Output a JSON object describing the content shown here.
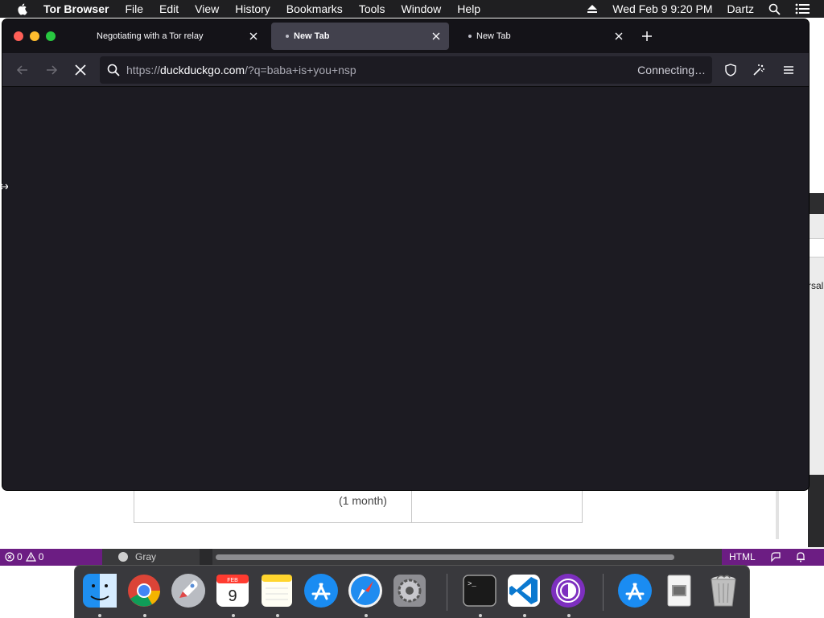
{
  "menubar": {
    "app_name": "Tor Browser",
    "items": [
      "File",
      "Edit",
      "View",
      "History",
      "Bookmarks",
      "Tools",
      "Window",
      "Help"
    ],
    "datetime": "Wed Feb 9  9:20 PM",
    "user": "Dartz",
    "icons": [
      "apple-icon",
      "eject-icon",
      "spotlight-search-icon",
      "notification-center-icon"
    ]
  },
  "browser": {
    "tabs": [
      {
        "title": "Negotiating with a Tor relay",
        "active": false,
        "loading_dot": false
      },
      {
        "title": "New Tab",
        "active": true,
        "loading_dot": true
      },
      {
        "title": "New Tab",
        "active": false,
        "loading_dot": true
      }
    ],
    "url": {
      "scheme": "https://",
      "domain": "duckduckgo.com",
      "path": "/?q=baba+is+you+nsp"
    },
    "status": "Connecting…",
    "nav_icons": [
      "back-icon",
      "forward-icon",
      "stop-icon",
      "shield-icon",
      "extensions-icon",
      "menu-icon"
    ]
  },
  "background": {
    "table_cell": "(1 month)",
    "right_fragment": "rsal",
    "status_left": {
      "errors": "0",
      "warnings": "0"
    },
    "gray_label": "Gray",
    "language": "HTML"
  },
  "dock": {
    "apps": [
      "finder-icon",
      "chrome-icon",
      "launchpad-icon",
      "calendar-icon",
      "notes-icon",
      "app-store-icon",
      "safari-icon",
      "system-preferences-icon",
      "terminal-icon",
      "vscode-icon",
      "tor-browser-icon",
      "app-store-download-icon",
      "preview-icon",
      "trash-icon"
    ],
    "calendar": {
      "month": "FEB",
      "day": "9"
    },
    "terminal_prompt": ">_"
  },
  "colors": {
    "window_bg": "#1c1b22",
    "tabbar_bg": "#141318",
    "navbar_bg": "#2b2a33",
    "active_tab_bg": "#42414d",
    "vscode_status_bg": "#6c1d83",
    "menubar_bg": "#1f1f21"
  }
}
